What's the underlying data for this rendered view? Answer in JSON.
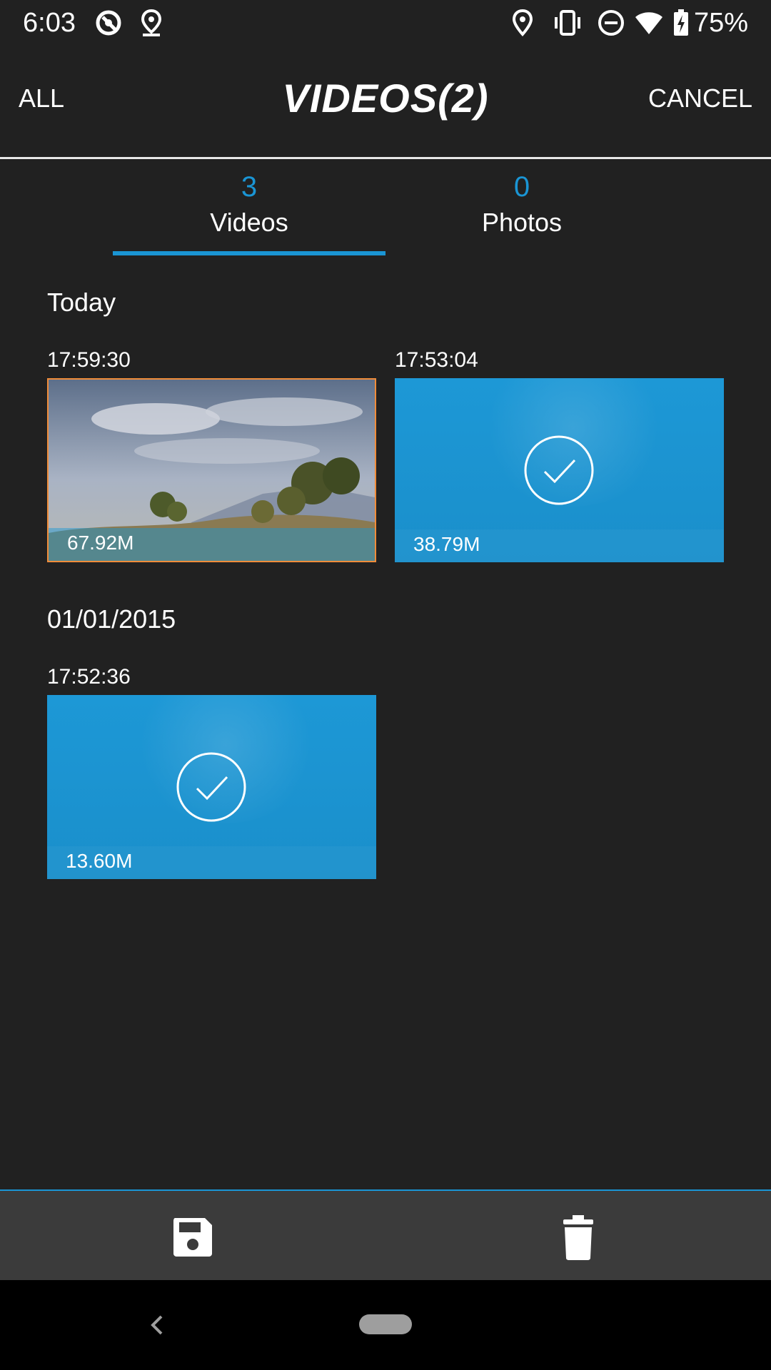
{
  "status_bar": {
    "time": "6:03",
    "battery_percent": "75%",
    "left_icons": [
      "sync-off-icon",
      "location-pin-outline-icon"
    ],
    "right_icons": [
      "location-icon",
      "vibrate-icon",
      "do-not-disturb-icon",
      "wifi-icon",
      "battery-charging-icon"
    ]
  },
  "header": {
    "all_label": "ALL",
    "title": "VIDEOS(2)",
    "cancel_label": "CANCEL"
  },
  "tabs": [
    {
      "count": "3",
      "label": "Videos",
      "selected": true
    },
    {
      "count": "0",
      "label": "Photos",
      "selected": false
    }
  ],
  "sections": [
    {
      "title": "Today",
      "items": [
        {
          "time": "17:59:30",
          "size": "67.92M",
          "thumbnail": "landscape",
          "selected": false,
          "highlighted": true
        },
        {
          "time": "17:53:04",
          "size": "38.79M",
          "thumbnail": "selected-overlay",
          "selected": true,
          "highlighted": false
        }
      ]
    },
    {
      "title": "01/01/2015",
      "items": [
        {
          "time": "17:52:36",
          "size": "13.60M",
          "thumbnail": "selected-overlay",
          "selected": true,
          "highlighted": false
        }
      ]
    }
  ],
  "bottom_actions": [
    "save-icon",
    "delete-icon"
  ],
  "colors": {
    "background": "#212121",
    "accent": "#1a95d4",
    "highlight_border": "#f08c3a",
    "bottom_bar": "#3b3b3b"
  }
}
